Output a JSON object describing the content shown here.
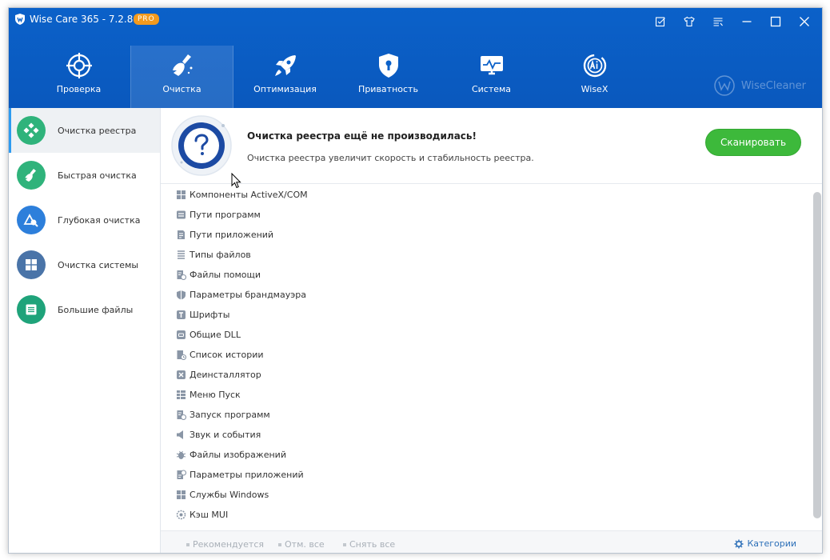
{
  "window": {
    "title": "Wise Care 365 - 7.2.8",
    "badge": "PRO"
  },
  "nav": {
    "tabs": [
      {
        "label": "Проверка",
        "icon": "crosshair-icon"
      },
      {
        "label": "Очистка",
        "icon": "broom-icon",
        "active": true
      },
      {
        "label": "Оптимизация",
        "icon": "rocket-icon"
      },
      {
        "label": "Приватность",
        "icon": "shield-lock-icon"
      },
      {
        "label": "Система",
        "icon": "monitor-icon"
      },
      {
        "label": "WiseX",
        "icon": "ai-icon"
      }
    ],
    "brand": "WiseCleaner"
  },
  "sidebar": {
    "items": [
      {
        "label": "Очистка реестра",
        "icon": "registry-icon",
        "color": "#2fb37b",
        "active": true
      },
      {
        "label": "Быстрая очистка",
        "icon": "quick-clean-icon",
        "color": "#2fb37b"
      },
      {
        "label": "Глубокая очистка",
        "icon": "deep-clean-icon",
        "color": "#2d7fdb"
      },
      {
        "label": "Очистка системы",
        "icon": "windows-icon",
        "color": "#4a74a8"
      },
      {
        "label": "Большие файлы",
        "icon": "big-files-icon",
        "color": "#1fa37a"
      }
    ]
  },
  "banner": {
    "title": "Очистка реестра ещё не производилась!",
    "subtitle": "Очистка реестра увеличит скорость и стабильность реестра.",
    "scan_button": "Сканировать"
  },
  "list": {
    "items": [
      {
        "label": "Компоненты ActiveX/COM",
        "icon": "grid-icon"
      },
      {
        "label": "Пути программ",
        "icon": "path-icon"
      },
      {
        "label": "Пути приложений",
        "icon": "app-path-icon"
      },
      {
        "label": "Типы файлов",
        "icon": "file-types-icon"
      },
      {
        "label": "Файлы помощи",
        "icon": "help-file-icon"
      },
      {
        "label": "Параметры брандмауэра",
        "icon": "firewall-icon"
      },
      {
        "label": "Шрифты",
        "icon": "font-icon"
      },
      {
        "label": "Общие DLL",
        "icon": "dll-icon"
      },
      {
        "label": "Список истории",
        "icon": "history-icon"
      },
      {
        "label": "Деинсталлятор",
        "icon": "uninstaller-icon"
      },
      {
        "label": "Меню Пуск",
        "icon": "start-menu-icon"
      },
      {
        "label": "Запуск программ",
        "icon": "startup-icon"
      },
      {
        "label": "Звук и события",
        "icon": "sound-icon"
      },
      {
        "label": "Файлы изображений",
        "icon": "bug-icon"
      },
      {
        "label": "Параметры приложений",
        "icon": "app-settings-icon"
      },
      {
        "label": "Службы Windows",
        "icon": "windows-services-icon"
      },
      {
        "label": "Кэш MUI",
        "icon": "mui-cache-icon"
      }
    ]
  },
  "footer": {
    "recommended": "Рекомендуется",
    "select_all": "Отм. все",
    "deselect_all": "Снять все",
    "categories": "Категории"
  },
  "colors": {
    "header": "#0b61c9",
    "scan_button": "#3db93b",
    "accent": "#2d9bf0"
  }
}
